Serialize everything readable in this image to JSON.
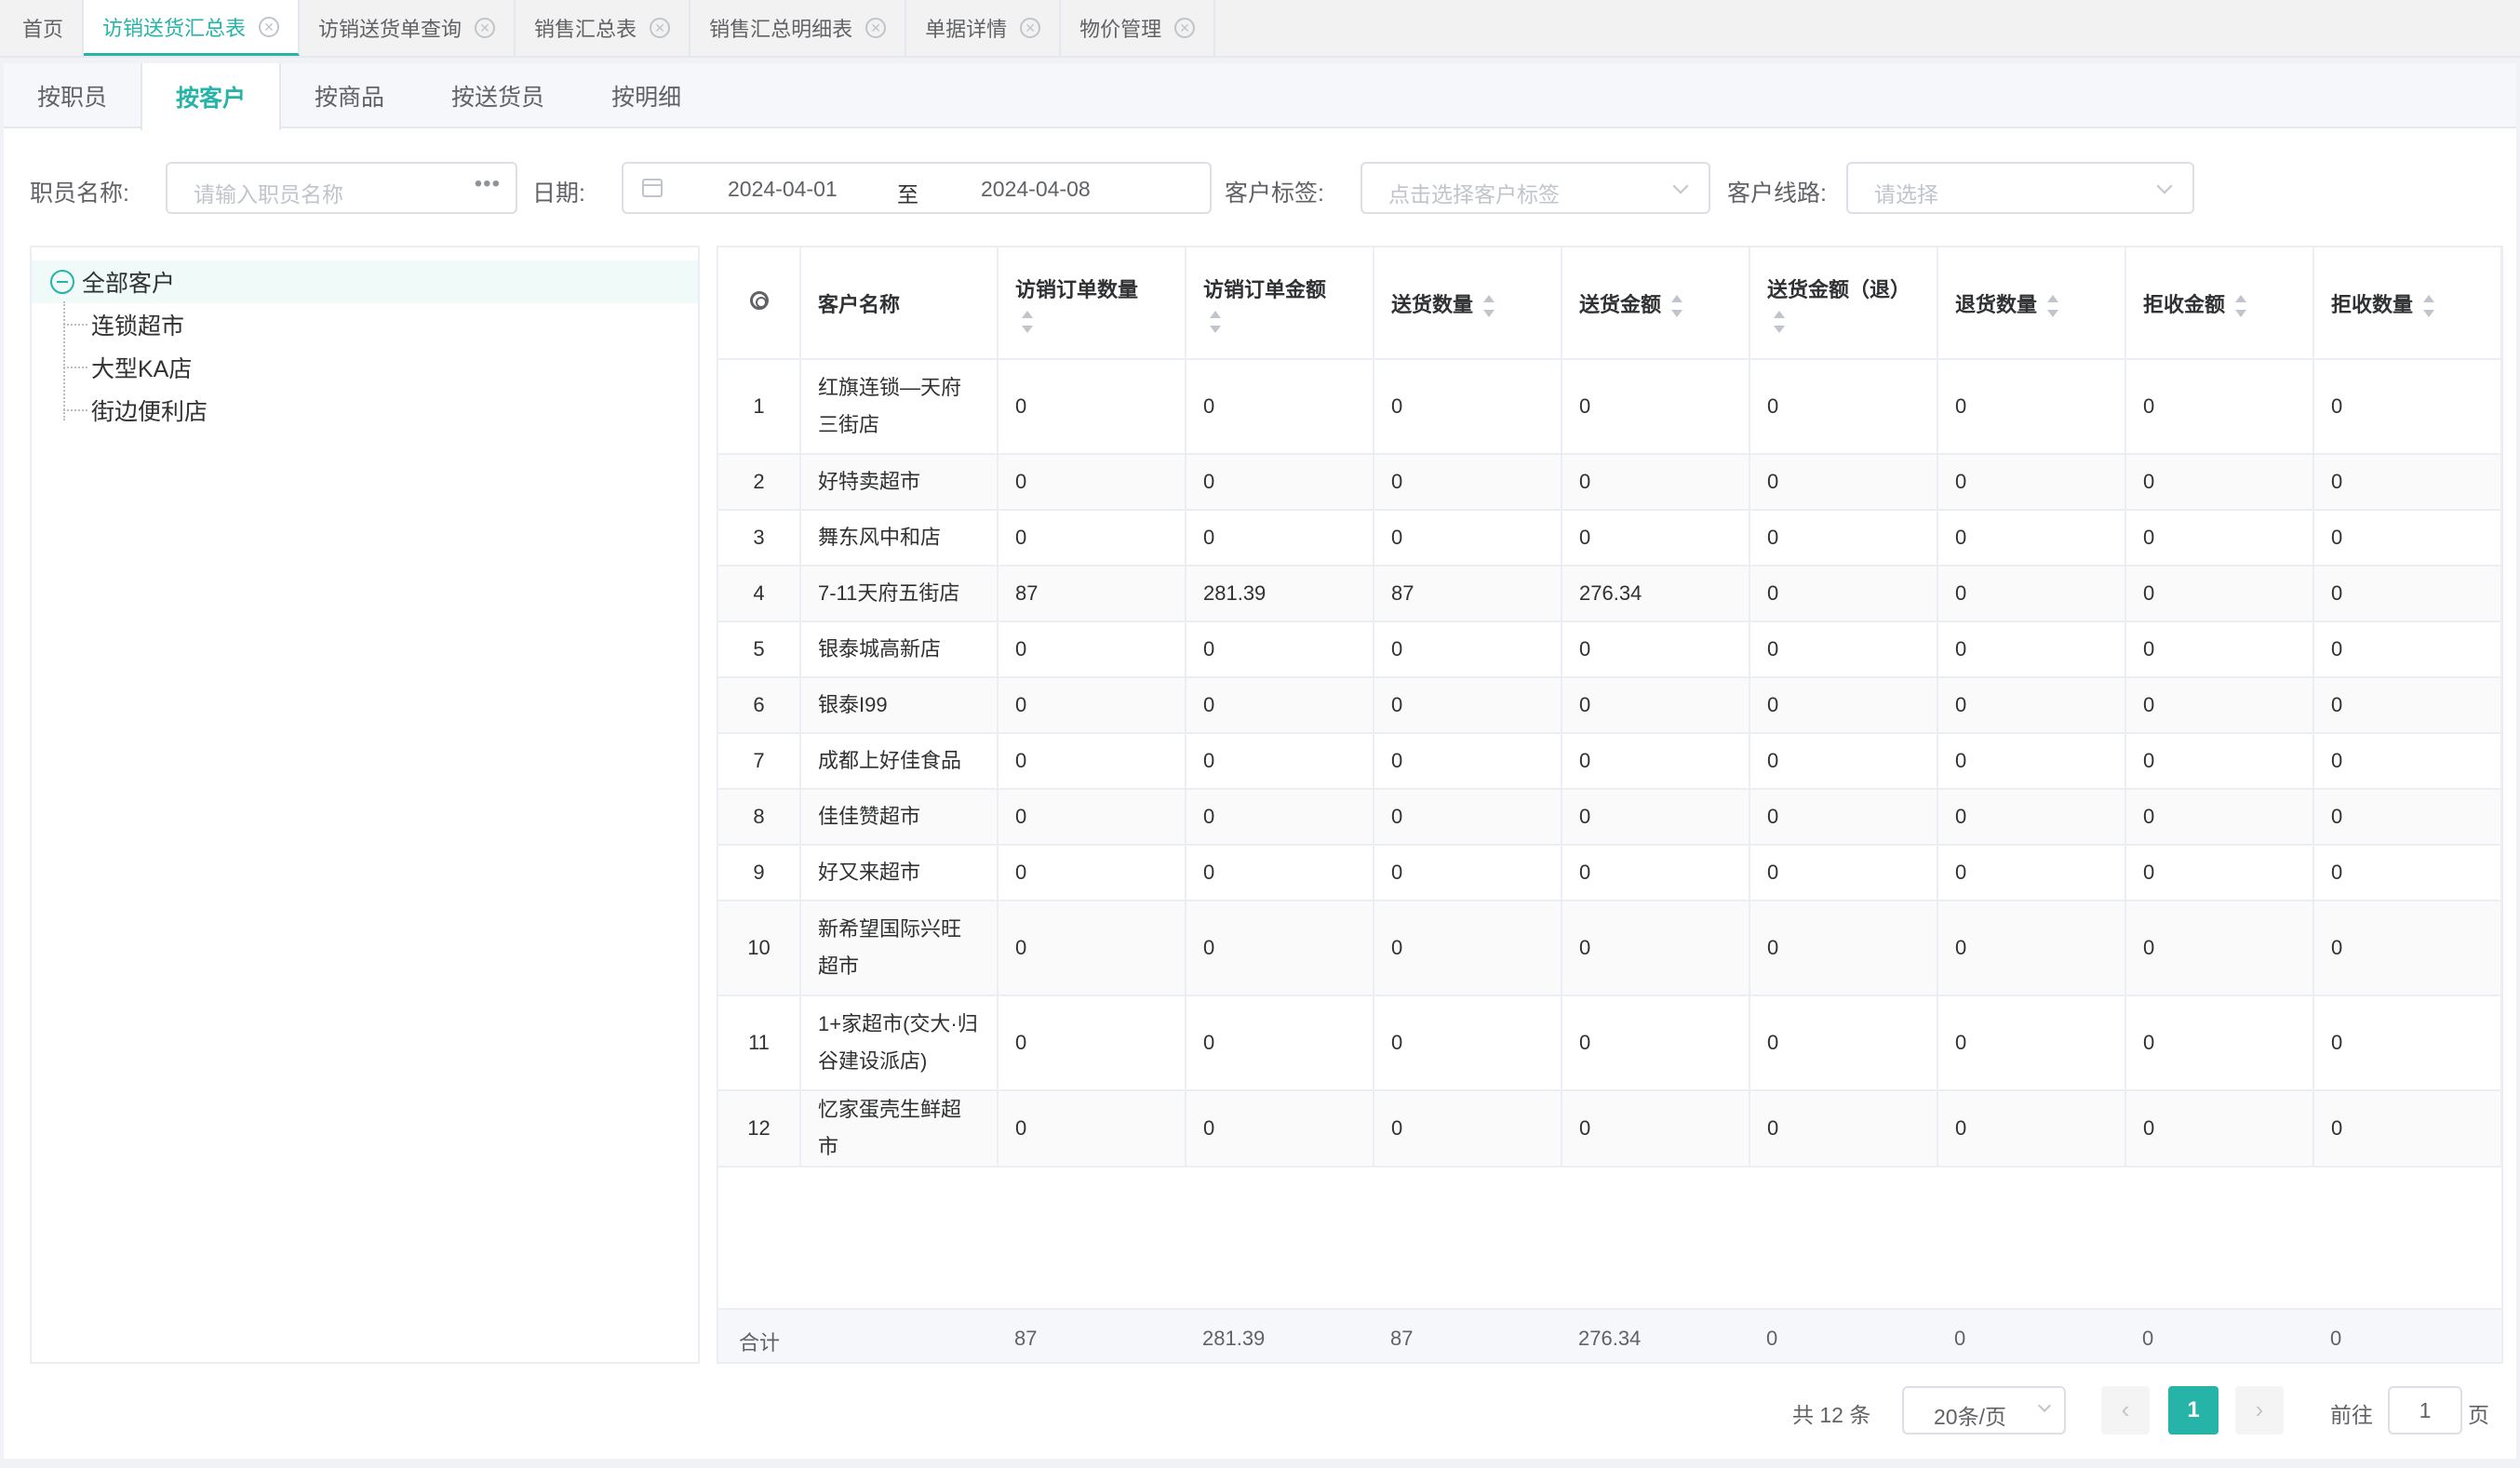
{
  "page_tabs": [
    {
      "label": "首页",
      "closable": false
    },
    {
      "label": "访销送货汇总表",
      "closable": true,
      "active": true
    },
    {
      "label": "访销送货单查询",
      "closable": true
    },
    {
      "label": "销售汇总表",
      "closable": true
    },
    {
      "label": "销售汇总明细表",
      "closable": true
    },
    {
      "label": "单据详情",
      "closable": true
    },
    {
      "label": "物价管理",
      "closable": true
    }
  ],
  "sub_tabs": [
    "按职员",
    "按客户",
    "按商品",
    "按送货员",
    "按明细"
  ],
  "active_sub_tab": "按客户",
  "filters": {
    "employee_label": "职员名称:",
    "employee_placeholder": "请输入职员名称",
    "date_label": "日期:",
    "date_start": "2024-04-01",
    "date_sep": "至",
    "date_end": "2024-04-08",
    "tag_label": "客户标签:",
    "tag_placeholder": "点击选择客户标签",
    "route_label": "客户线路:",
    "route_placeholder": "请选择"
  },
  "tree": {
    "root": "全部客户",
    "children": [
      "连锁超市",
      "大型KA店",
      "街边便利店"
    ]
  },
  "table": {
    "columns": [
      "客户名称",
      "访销订单数量",
      "访销订单金额",
      "送货数量",
      "送货金额",
      "送货金额（退）",
      "退货数量",
      "拒收金额",
      "拒收数量"
    ],
    "rows": [
      {
        "idx": "1",
        "name": "红旗连锁—天府三街店",
        "v": [
          "0",
          "0",
          "0",
          "0",
          "0",
          "0",
          "0",
          "0"
        ]
      },
      {
        "idx": "2",
        "name": "好特卖超市",
        "v": [
          "0",
          "0",
          "0",
          "0",
          "0",
          "0",
          "0",
          "0"
        ]
      },
      {
        "idx": "3",
        "name": "舞东风中和店",
        "v": [
          "0",
          "0",
          "0",
          "0",
          "0",
          "0",
          "0",
          "0"
        ]
      },
      {
        "idx": "4",
        "name": "7-11天府五街店",
        "v": [
          "87",
          "281.39",
          "87",
          "276.34",
          "0",
          "0",
          "0",
          "0"
        ]
      },
      {
        "idx": "5",
        "name": "银泰城高新店",
        "v": [
          "0",
          "0",
          "0",
          "0",
          "0",
          "0",
          "0",
          "0"
        ]
      },
      {
        "idx": "6",
        "name": "银泰I99",
        "v": [
          "0",
          "0",
          "0",
          "0",
          "0",
          "0",
          "0",
          "0"
        ]
      },
      {
        "idx": "7",
        "name": "成都上好佳食品",
        "v": [
          "0",
          "0",
          "0",
          "0",
          "0",
          "0",
          "0",
          "0"
        ]
      },
      {
        "idx": "8",
        "name": "佳佳赞超市",
        "v": [
          "0",
          "0",
          "0",
          "0",
          "0",
          "0",
          "0",
          "0"
        ]
      },
      {
        "idx": "9",
        "name": "好又来超市",
        "v": [
          "0",
          "0",
          "0",
          "0",
          "0",
          "0",
          "0",
          "0"
        ]
      },
      {
        "idx": "10",
        "name": "新希望国际兴旺超市",
        "v": [
          "0",
          "0",
          "0",
          "0",
          "0",
          "0",
          "0",
          "0"
        ]
      },
      {
        "idx": "11",
        "name": "1+家超市(交大·归谷建设派店)",
        "v": [
          "0",
          "0",
          "0",
          "0",
          "0",
          "0",
          "0",
          "0"
        ]
      },
      {
        "idx": "12",
        "name": "忆家蛋壳生鲜超市",
        "v": [
          "0",
          "0",
          "0",
          "0",
          "0",
          "0",
          "0",
          "0"
        ]
      }
    ],
    "summary_label": "合计",
    "summary": [
      "87",
      "281.39",
      "87",
      "276.34",
      "0",
      "0",
      "0",
      "0"
    ]
  },
  "pagination": {
    "total": "共 12 条",
    "page_size": "20条/页",
    "current_page": "1",
    "goto_label": "前往",
    "goto_value": "1",
    "page_suffix": "页"
  },
  "colors": {
    "accent": "#26b3a8",
    "border": "#ebeef5"
  }
}
